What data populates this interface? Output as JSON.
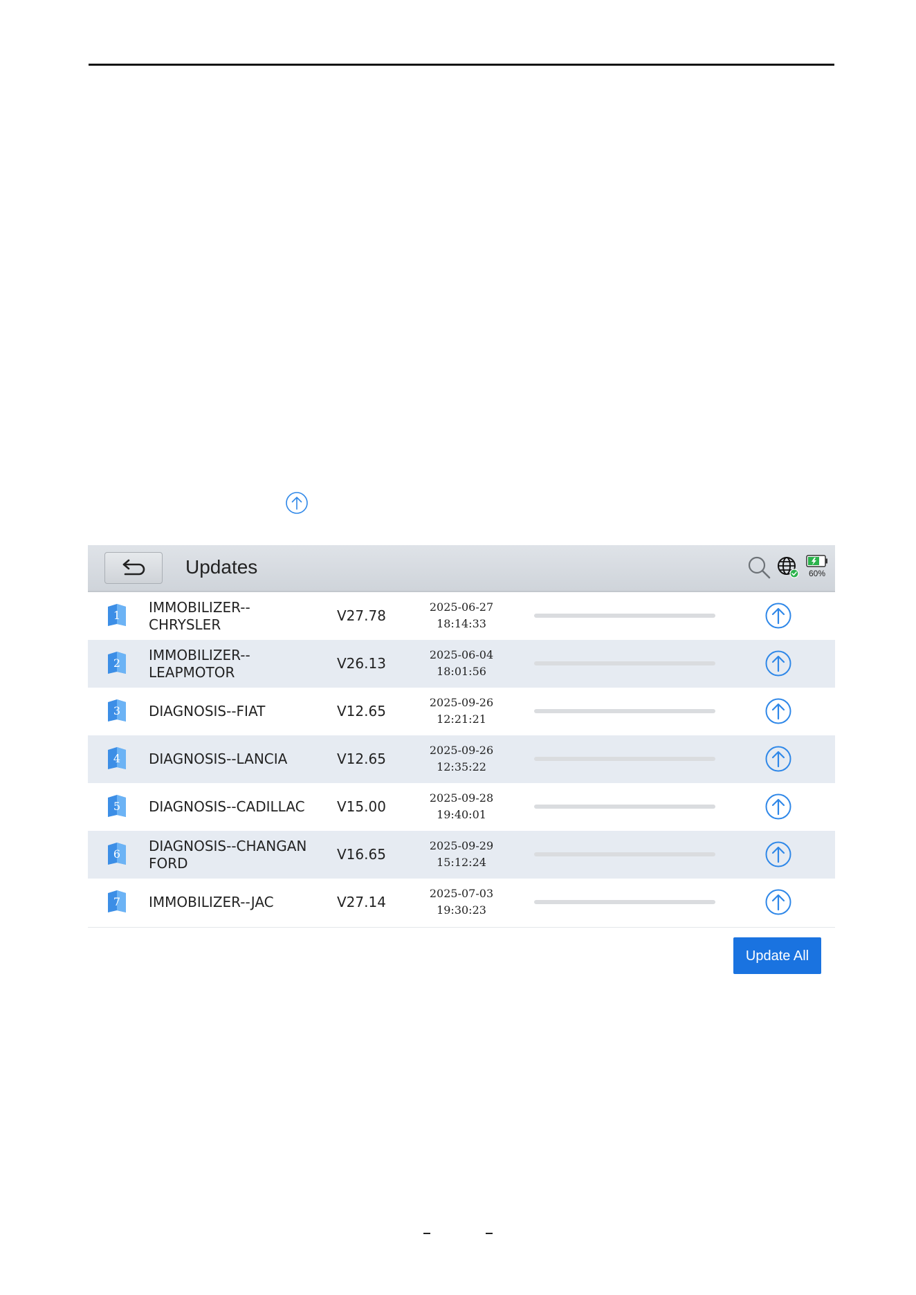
{
  "header": {
    "title": "Updates",
    "battery_percent": "60%"
  },
  "rows": [
    {
      "index": "1",
      "name": "IMMOBILIZER--\nCHRYSLER",
      "version": "V27.78",
      "date": "2025-06-27",
      "time": "18:14:33",
      "progress": 0
    },
    {
      "index": "2",
      "name": "IMMOBILIZER--\nLEAPMOTOR",
      "version": "V26.13",
      "date": "2025-06-04",
      "time": "18:01:56",
      "progress": 0
    },
    {
      "index": "3",
      "name": "DIAGNOSIS--FIAT",
      "version": "V12.65",
      "date": "2025-09-26",
      "time": "12:21:21",
      "progress": 0
    },
    {
      "index": "4",
      "name": "DIAGNOSIS--LANCIA",
      "version": "V12.65",
      "date": "2025-09-26",
      "time": "12:35:22",
      "progress": 0
    },
    {
      "index": "5",
      "name": "DIAGNOSIS--CADILLAC",
      "version": "V15.00",
      "date": "2025-09-28",
      "time": "19:40:01",
      "progress": 0
    },
    {
      "index": "6",
      "name": "DIAGNOSIS--CHANGAN\nFORD",
      "version": "V16.65",
      "date": "2025-09-29",
      "time": "15:12:24",
      "progress": 0
    },
    {
      "index": "7",
      "name": "IMMOBILIZER--JAC",
      "version": "V27.14",
      "date": "2025-07-03",
      "time": "19:30:23",
      "progress": 0
    }
  ],
  "footer": {
    "update_all_label": "Update All"
  },
  "icons": {
    "back": "back-arrow-icon",
    "search": "search-icon",
    "network": "globe-icon",
    "battery": "battery-icon",
    "update": "upload-arrow-icon",
    "badge": "folder-badge-icon"
  },
  "colors": {
    "accent": "#1a73e0",
    "row_alt": "#e6ebf2",
    "header": "#d6dadf",
    "icon_blue": "#2e87e8"
  }
}
